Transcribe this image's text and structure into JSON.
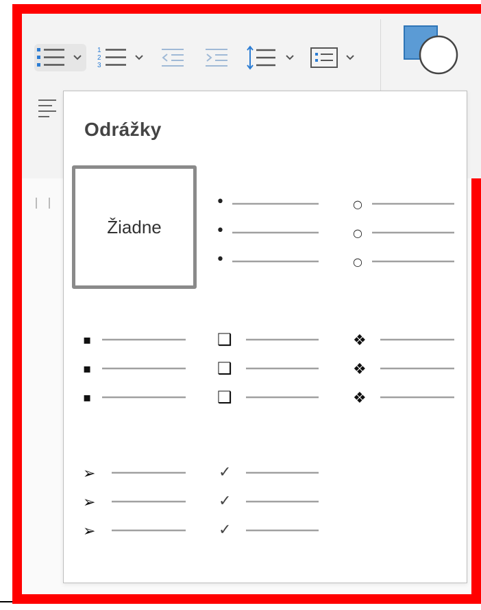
{
  "toolbar": {
    "buttons": [
      {
        "name": "bullets-button",
        "icon": "bullets-icon"
      },
      {
        "name": "numbering-button",
        "icon": "numbering-icon"
      },
      {
        "name": "decrease-indent-button",
        "icon": "decrease-indent-icon"
      },
      {
        "name": "increase-indent-button",
        "icon": "increase-indent-icon"
      },
      {
        "name": "line-spacing-button",
        "icon": "line-spacing-icon"
      },
      {
        "name": "list-style-button",
        "icon": "list-style-icon"
      },
      {
        "name": "shapes-button",
        "icon": "shapes-icon"
      }
    ]
  },
  "bullets_panel": {
    "title": "Odrážky",
    "options": [
      {
        "id": "none",
        "label": "Žiadne",
        "selected": true
      },
      {
        "id": "filled-round",
        "glyph": "•"
      },
      {
        "id": "hollow-round",
        "glyph": "○"
      },
      {
        "id": "filled-square",
        "glyph": "▪"
      },
      {
        "id": "hollow-square",
        "glyph": "❑"
      },
      {
        "id": "star-diamond",
        "glyph": "❖"
      },
      {
        "id": "arrow",
        "glyph": "➢"
      },
      {
        "id": "checkmark",
        "glyph": "✓"
      }
    ]
  },
  "colors": {
    "frame": "#ff0000",
    "accent_blue": "#2b7cd3",
    "selected_border": "#8a8a8a",
    "line_gray": "#a0a0a0"
  }
}
